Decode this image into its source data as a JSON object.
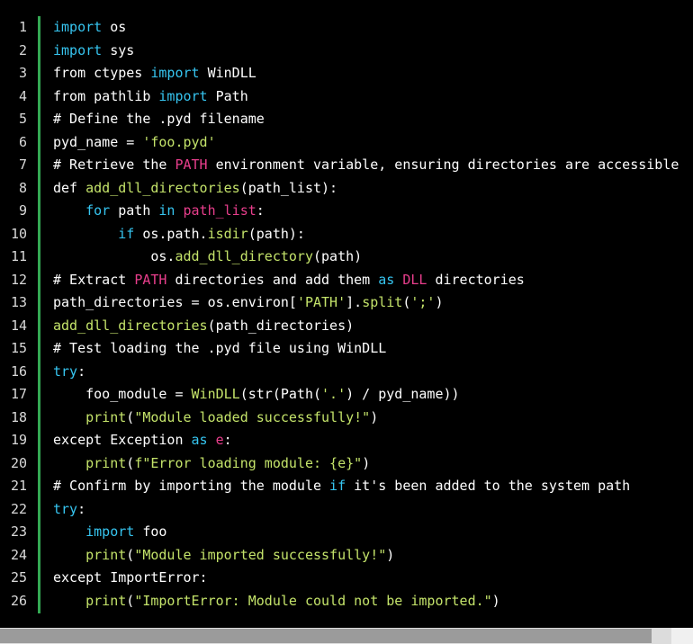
{
  "colors": {
    "background": "#000000",
    "gutter_border": "#34a853",
    "line_number": "#d9d9d9",
    "plain": "#ffffff",
    "keyword": "#36c5f0",
    "string": "#c4e36a",
    "builtin": "#e83e8c"
  },
  "code": {
    "lines": [
      {
        "number": "1",
        "tokens": [
          {
            "t": "import",
            "k": "keyword"
          },
          {
            "t": " os",
            "k": "plain"
          }
        ]
      },
      {
        "number": "2",
        "tokens": [
          {
            "t": "import",
            "k": "keyword"
          },
          {
            "t": " sys",
            "k": "plain"
          }
        ]
      },
      {
        "number": "3",
        "tokens": [
          {
            "t": "from ctypes ",
            "k": "plain"
          },
          {
            "t": "import",
            "k": "keyword"
          },
          {
            "t": " WinDLL",
            "k": "plain"
          }
        ]
      },
      {
        "number": "4",
        "tokens": [
          {
            "t": "from pathlib ",
            "k": "plain"
          },
          {
            "t": "import",
            "k": "keyword"
          },
          {
            "t": " Path",
            "k": "plain"
          }
        ]
      },
      {
        "number": "5",
        "tokens": [
          {
            "t": "# Define the .pyd filename",
            "k": "comment"
          }
        ]
      },
      {
        "number": "6",
        "tokens": [
          {
            "t": "pyd_name = ",
            "k": "plain"
          },
          {
            "t": "'foo.pyd'",
            "k": "string"
          }
        ]
      },
      {
        "number": "7",
        "tokens": [
          {
            "t": "# Retrieve the ",
            "k": "comment"
          },
          {
            "t": "PATH",
            "k": "builtin"
          },
          {
            "t": " environment variable, ensuring directories are accessible",
            "k": "comment"
          }
        ]
      },
      {
        "number": "8",
        "tokens": [
          {
            "t": "def ",
            "k": "plain"
          },
          {
            "t": "add_dll_directories",
            "k": "func"
          },
          {
            "t": "(path_list):",
            "k": "plain"
          }
        ]
      },
      {
        "number": "9",
        "tokens": [
          {
            "t": "    ",
            "k": "plain"
          },
          {
            "t": "for",
            "k": "keyword"
          },
          {
            "t": " path ",
            "k": "plain"
          },
          {
            "t": "in",
            "k": "keyword"
          },
          {
            "t": " ",
            "k": "plain"
          },
          {
            "t": "path_list",
            "k": "builtin"
          },
          {
            "t": ":",
            "k": "plain"
          }
        ]
      },
      {
        "number": "10",
        "tokens": [
          {
            "t": "        ",
            "k": "plain"
          },
          {
            "t": "if",
            "k": "keyword"
          },
          {
            "t": " os.path.",
            "k": "plain"
          },
          {
            "t": "isdir",
            "k": "func"
          },
          {
            "t": "(path):",
            "k": "plain"
          }
        ]
      },
      {
        "number": "11",
        "tokens": [
          {
            "t": "            os.",
            "k": "plain"
          },
          {
            "t": "add_dll_directory",
            "k": "func"
          },
          {
            "t": "(path)",
            "k": "plain"
          }
        ]
      },
      {
        "number": "12",
        "tokens": [
          {
            "t": "# Extract ",
            "k": "comment"
          },
          {
            "t": "PATH",
            "k": "builtin"
          },
          {
            "t": " directories and add them ",
            "k": "comment"
          },
          {
            "t": "as",
            "k": "keyword"
          },
          {
            "t": " ",
            "k": "comment"
          },
          {
            "t": "DLL",
            "k": "builtin"
          },
          {
            "t": " directories",
            "k": "comment"
          }
        ]
      },
      {
        "number": "13",
        "tokens": [
          {
            "t": "path_directories = os.environ[",
            "k": "plain"
          },
          {
            "t": "'PATH'",
            "k": "string"
          },
          {
            "t": "].",
            "k": "plain"
          },
          {
            "t": "split",
            "k": "func"
          },
          {
            "t": "(",
            "k": "plain"
          },
          {
            "t": "';'",
            "k": "string"
          },
          {
            "t": ")",
            "k": "plain"
          }
        ]
      },
      {
        "number": "14",
        "tokens": [
          {
            "t": "add_dll_directories",
            "k": "func"
          },
          {
            "t": "(path_directories)",
            "k": "plain"
          }
        ]
      },
      {
        "number": "15",
        "tokens": [
          {
            "t": "# Test loading the .pyd file using WinDLL",
            "k": "comment"
          }
        ]
      },
      {
        "number": "16",
        "tokens": [
          {
            "t": "try",
            "k": "keyword"
          },
          {
            "t": ":",
            "k": "plain"
          }
        ]
      },
      {
        "number": "17",
        "tokens": [
          {
            "t": "    foo_module = ",
            "k": "plain"
          },
          {
            "t": "WinDLL",
            "k": "func"
          },
          {
            "t": "(str(Path(",
            "k": "plain"
          },
          {
            "t": "'.'",
            "k": "string"
          },
          {
            "t": ") / pyd_name))",
            "k": "plain"
          }
        ]
      },
      {
        "number": "18",
        "tokens": [
          {
            "t": "    ",
            "k": "plain"
          },
          {
            "t": "print",
            "k": "func"
          },
          {
            "t": "(",
            "k": "plain"
          },
          {
            "t": "\"Module loaded successfully!\"",
            "k": "string"
          },
          {
            "t": ")",
            "k": "plain"
          }
        ]
      },
      {
        "number": "19",
        "tokens": [
          {
            "t": "except Exception ",
            "k": "plain"
          },
          {
            "t": "as",
            "k": "keyword"
          },
          {
            "t": " ",
            "k": "plain"
          },
          {
            "t": "e",
            "k": "builtin"
          },
          {
            "t": ":",
            "k": "plain"
          }
        ]
      },
      {
        "number": "20",
        "tokens": [
          {
            "t": "    ",
            "k": "plain"
          },
          {
            "t": "print",
            "k": "func"
          },
          {
            "t": "(",
            "k": "plain"
          },
          {
            "t": "f\"Error loading module: {e}\"",
            "k": "string"
          },
          {
            "t": ")",
            "k": "plain"
          }
        ]
      },
      {
        "number": "21",
        "tokens": [
          {
            "t": "# Confirm by importing the module ",
            "k": "comment"
          },
          {
            "t": "if",
            "k": "keyword"
          },
          {
            "t": " it's been added to the system path",
            "k": "comment"
          }
        ]
      },
      {
        "number": "22",
        "tokens": [
          {
            "t": "try",
            "k": "keyword"
          },
          {
            "t": ":",
            "k": "plain"
          }
        ]
      },
      {
        "number": "23",
        "tokens": [
          {
            "t": "    ",
            "k": "plain"
          },
          {
            "t": "import",
            "k": "keyword"
          },
          {
            "t": " foo",
            "k": "plain"
          }
        ]
      },
      {
        "number": "24",
        "tokens": [
          {
            "t": "    ",
            "k": "plain"
          },
          {
            "t": "print",
            "k": "func"
          },
          {
            "t": "(",
            "k": "plain"
          },
          {
            "t": "\"Module imported successfully!\"",
            "k": "string"
          },
          {
            "t": ")",
            "k": "plain"
          }
        ]
      },
      {
        "number": "25",
        "tokens": [
          {
            "t": "except ImportError:",
            "k": "plain"
          }
        ]
      },
      {
        "number": "26",
        "tokens": [
          {
            "t": "    ",
            "k": "plain"
          },
          {
            "t": "print",
            "k": "func"
          },
          {
            "t": "(",
            "k": "plain"
          },
          {
            "t": "\"ImportError: Module could not be imported.\"",
            "k": "string"
          },
          {
            "t": ")",
            "k": "plain"
          }
        ]
      }
    ]
  },
  "scrollbar": {
    "orientation": "horizontal",
    "position_fraction": 0.0,
    "visible_fraction": 0.97
  }
}
